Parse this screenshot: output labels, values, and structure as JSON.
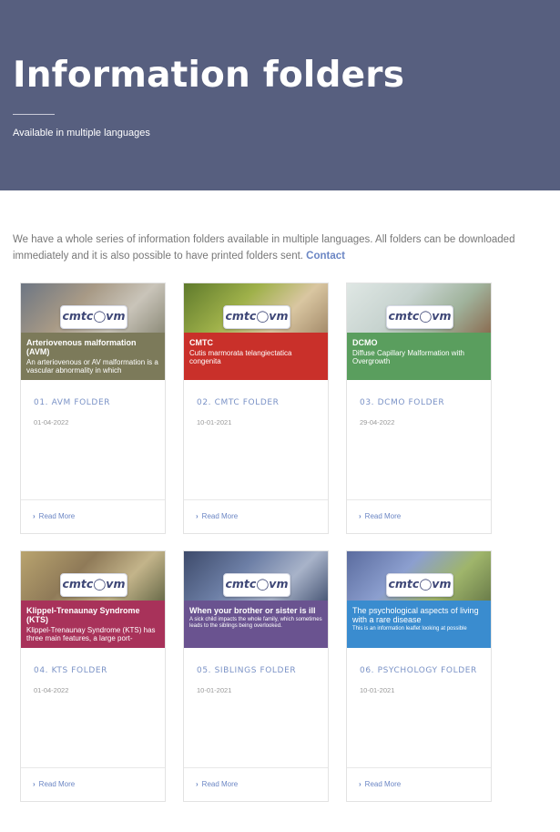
{
  "hero": {
    "title": "Information folders",
    "subtitle": "Available in multiple languages"
  },
  "intro": {
    "text": "We have a whole series of information folders available in multiple languages. All folders can be downloaded immediately and it is also possible to have printed folders sent. ",
    "link": "Contact"
  },
  "logo_text": "cmtc◯vm",
  "read_more": "Read More",
  "cards": [
    {
      "title": "01. AVM FOLDER",
      "date": "01-04-2022",
      "band_title": "Arteriovenous malformation (AVM)",
      "band_sub": "An arteriovenous or AV malformation is a vascular abnormality in which",
      "band_color": "#7c7a5a"
    },
    {
      "title": "02. CMTC FOLDER",
      "date": "10-01-2021",
      "band_title": "CMTC",
      "band_sub": "Cutis marmorata telangiectatica congenita",
      "band_color": "#c9302a"
    },
    {
      "title": "03. DCMO FOLDER",
      "date": "29-04-2022",
      "band_title": "DCMO",
      "band_sub": "Diffuse Capillary Malformation with Overgrowth",
      "band_color": "#5a9e5e"
    },
    {
      "title": "04. KTS FOLDER",
      "date": "01-04-2022",
      "band_title": "Klippel-Trenaunay Syndrome (KTS)",
      "band_sub": "Klippel-Trenaunay Syndrome (KTS) has three main features, a large port-",
      "band_color": "#a8325a"
    },
    {
      "title": "05. SIBLINGS FOLDER",
      "date": "10-01-2021",
      "band_title": "When your brother or sister is ill",
      "band_sub": "A sick child impacts the whole family, which sometimes leads to the siblings being overlooked.",
      "band_color": "#6a5390"
    },
    {
      "title": "06. PSYCHOLOGY FOLDER",
      "date": "10-01-2021",
      "band_title": "The psychological aspects of living with a rare disease",
      "band_sub": "This is an information leaflet looking at possible",
      "band_color": "#3a8ccf"
    }
  ]
}
